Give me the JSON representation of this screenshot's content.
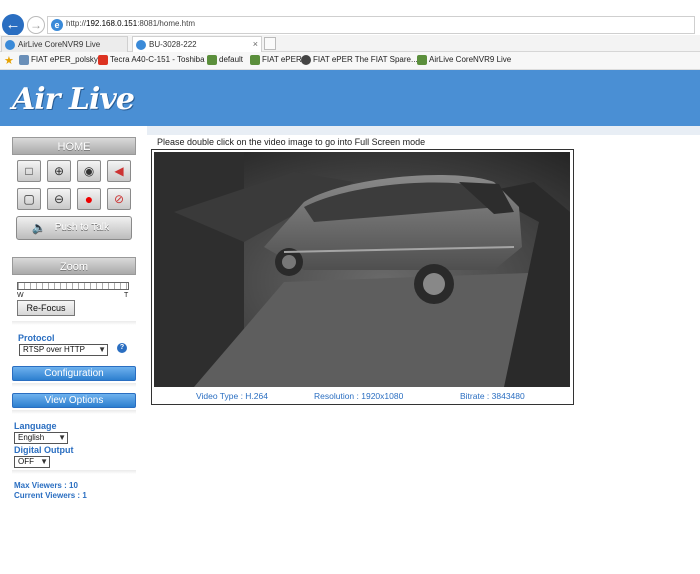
{
  "browser": {
    "url_prefix": "http://",
    "url_host": "192.168.0.151",
    "url_rest": ":8081/home.htm",
    "tabs": [
      {
        "label": "AirLive CoreNVR9 Live"
      },
      {
        "label": "BU-3028-222"
      }
    ],
    "favorites": [
      {
        "label": "FIAT ePER_polsky"
      },
      {
        "label": "Tecra A40-C-151 - Toshiba"
      },
      {
        "label": "default"
      },
      {
        "label": "FIAT ePER"
      },
      {
        "label": "FIAT ePER  The FIAT Spare..."
      },
      {
        "label": "AirLive CoreNVR9 Live"
      }
    ]
  },
  "header": {
    "logo": "Air Live"
  },
  "sidebar": {
    "home_title": "HOME",
    "push_to_talk": "Push to Talk",
    "zoom_title": "Zoom",
    "zoom_w": "W",
    "zoom_t": "T",
    "refocus": "Re-Focus",
    "protocol_label": "Protocol",
    "protocol_value": "RTSP over HTTP",
    "configuration": "Configuration",
    "view_options": "View Options",
    "language_label": "Language",
    "language_value": "English",
    "digital_output_label": "Digital Output",
    "digital_output_value": "OFF",
    "max_viewers": "Max Viewers :  10",
    "current_viewers": "Current Viewers :  1"
  },
  "main": {
    "notice": "Please double click on the video image to go into Full Screen mode",
    "video_type": "Video Type :  H.264",
    "resolution": "Resolution :  1920x1080",
    "bitrate": "Bitrate :  3843480"
  }
}
